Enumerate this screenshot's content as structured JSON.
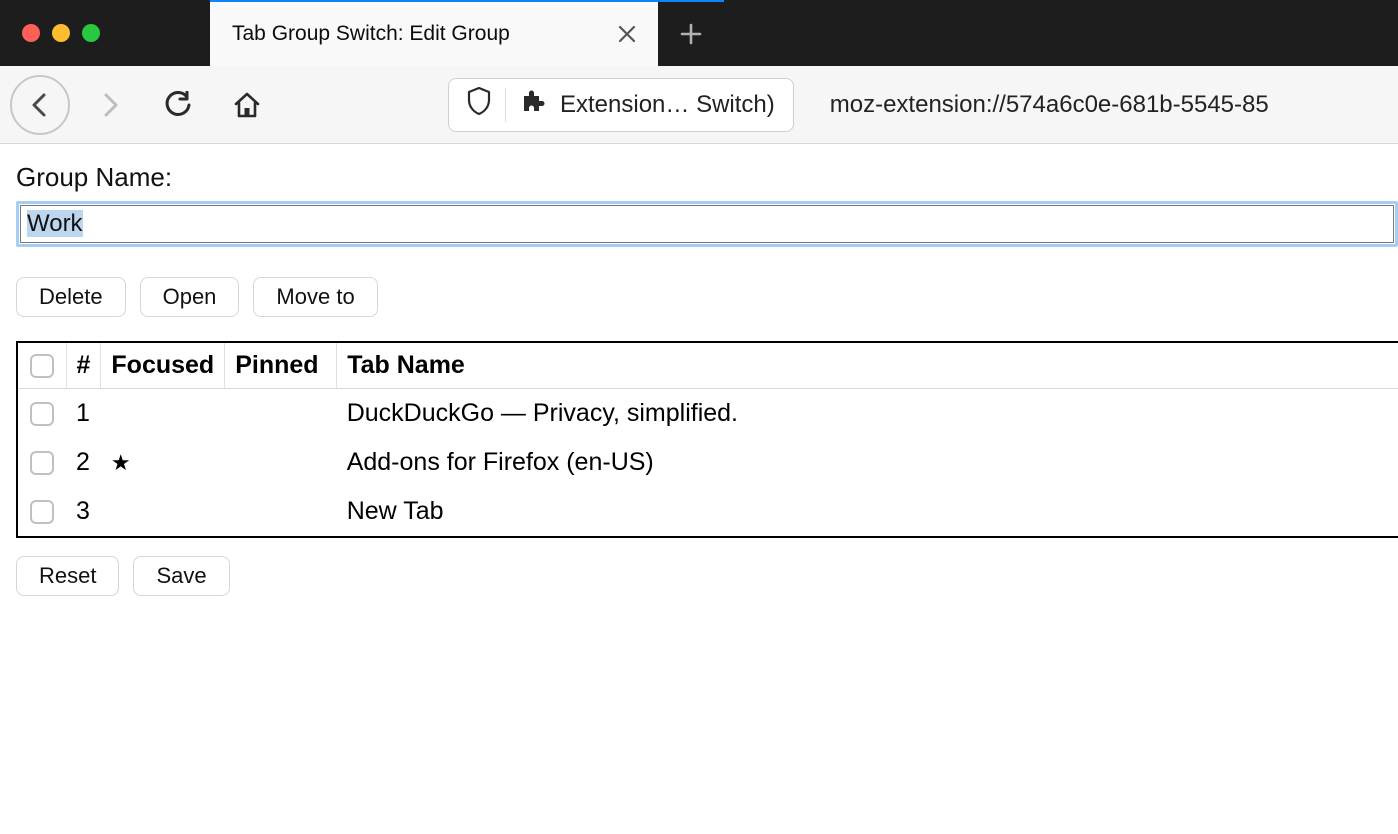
{
  "window": {
    "tab_title": "Tab Group Switch: Edit Group"
  },
  "toolbar": {
    "identity_label": "Extension… Switch)",
    "url": "moz-extension://574a6c0e-681b-5545-85"
  },
  "page": {
    "group_name_label": "Group Name:",
    "group_name_value": "Work",
    "actions": {
      "delete": "Delete",
      "open": "Open",
      "move_to": "Move to"
    },
    "table": {
      "headers": {
        "index": "#",
        "focused": "Focused",
        "pinned": "Pinned",
        "tab_name": "Tab Name"
      },
      "rows": [
        {
          "index": "1",
          "focused": "",
          "pinned": "",
          "name": "DuckDuckGo — Privacy, simplified."
        },
        {
          "index": "2",
          "focused": "★",
          "pinned": "",
          "name": "Add-ons for Firefox (en-US)"
        },
        {
          "index": "3",
          "focused": "",
          "pinned": "",
          "name": "New Tab"
        }
      ]
    },
    "footer": {
      "reset": "Reset",
      "save": "Save"
    }
  }
}
